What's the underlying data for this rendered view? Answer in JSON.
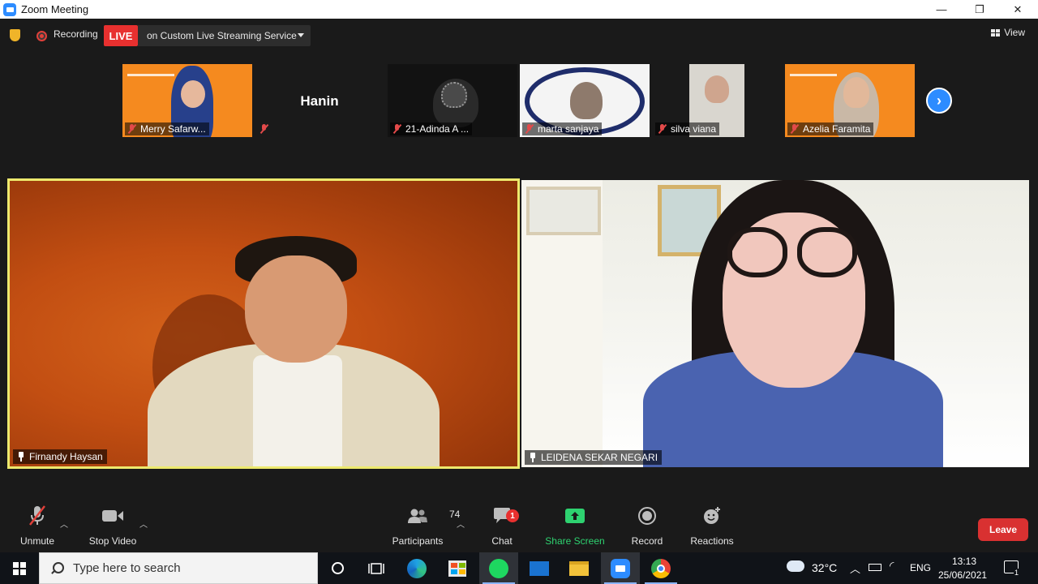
{
  "window": {
    "title": "Zoom Meeting",
    "minimize": "—",
    "maximize": "❐",
    "close": "✕"
  },
  "meeting_bar": {
    "recording_label": "Recording",
    "live_label": "LIVE",
    "stream_service": "on Custom Live Streaming Service",
    "view_label": "View"
  },
  "thumbnails": [
    {
      "name": "Merry Safarw...",
      "muted": true
    },
    {
      "name": "Hanin",
      "muted": true
    },
    {
      "name": "21-Adinda A ...",
      "muted": true
    },
    {
      "name": "marta sanjaya",
      "muted": true
    },
    {
      "name": "silva viana",
      "muted": true
    },
    {
      "name": "Azelia Faramita",
      "muted": true
    }
  ],
  "thumbnail_banner_text": "WEBINAR PIKOMBRES 21",
  "main_tiles": [
    {
      "name": "Firnandy Haysan",
      "pinned": true,
      "active_speaker": true
    },
    {
      "name": "LEIDENA SEKAR NEGARI",
      "pinned": true,
      "active_speaker": false
    }
  ],
  "toolbar": {
    "unmute": "Unmute",
    "stop_video": "Stop Video",
    "participants": "Participants",
    "participants_count": "74",
    "chat": "Chat",
    "chat_badge": "1",
    "share_screen": "Share Screen",
    "record": "Record",
    "reactions": "Reactions",
    "leave": "Leave"
  },
  "taskbar": {
    "search_placeholder": "Type here to search",
    "weather": "32°C",
    "language": "ENG",
    "time": "13:13",
    "date": "25/06/2021",
    "notification_count": "1"
  },
  "colors": {
    "live_red": "#e8302f",
    "share_green": "#2ed270",
    "zoom_blue": "#2d8cff",
    "active_speaker_border": "#ede96d"
  }
}
